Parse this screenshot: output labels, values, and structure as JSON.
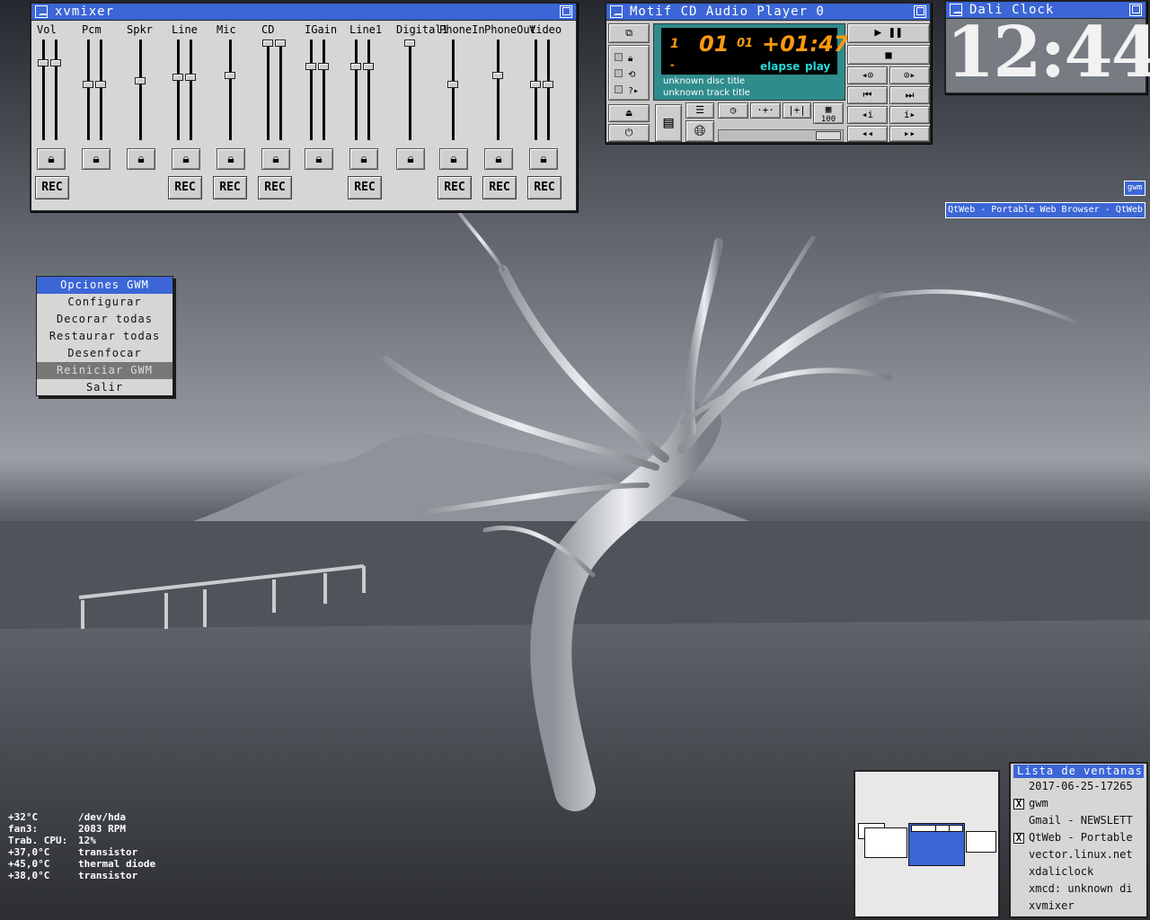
{
  "xvmixer": {
    "title": "xvmixer",
    "channels": [
      {
        "label": "Vol",
        "rec": true
      },
      {
        "label": "Pcm",
        "rec": false
      },
      {
        "label": "Spkr",
        "rec": false
      },
      {
        "label": "Line",
        "rec": true
      },
      {
        "label": "Mic",
        "rec": true
      },
      {
        "label": "CD",
        "rec": true
      },
      {
        "label": "IGain",
        "rec": false
      },
      {
        "label": "Line1",
        "rec": true
      },
      {
        "label": "Digital1",
        "rec": false
      },
      {
        "label": "PhoneIn",
        "rec": true
      },
      {
        "label": "PhoneOut",
        "rec": true
      },
      {
        "label": "Video",
        "rec": true
      }
    ],
    "rec_label": "REC",
    "lock_icon": "padlock-icon"
  },
  "cdplayer": {
    "title": "Motif CD Audio Player 0",
    "lcd": {
      "track": "1",
      "index": "01",
      "index_small": "01",
      "time": "+01:47",
      "dash": "-",
      "mode_elapse": "elapse",
      "mode_play": "play"
    },
    "disc_title": "unknown disc title",
    "track_title": "unknown track title",
    "volume_value": "100"
  },
  "daliclock": {
    "title": "Dali Clock",
    "time": "12:44"
  },
  "gwm_menu": {
    "title": "Opciones GWM",
    "items": [
      "Configurar",
      "Decorar todas",
      "Restaurar todas",
      "Desenfocar",
      "Reiniciar GWM",
      "Salir"
    ]
  },
  "icons": {
    "gwm": "gwm",
    "qtweb": "QtWeb - Portable Web Browser - QtWeb"
  },
  "sensors": [
    {
      "value": "+32°C",
      "label": "/dev/hda"
    },
    {
      "value": "fan3:",
      "label": "2083 RPM"
    },
    {
      "value": "Trab. CPU:",
      "label": "12%"
    },
    {
      "value": "+37,0°C",
      "label": "transistor"
    },
    {
      "value": "+45,0°C",
      "label": "thermal diode"
    },
    {
      "value": "+38,0°C",
      "label": "transistor"
    }
  ],
  "winlist": {
    "title": "Lista de ventanas",
    "items": [
      {
        "label": "2017-06-25-17265",
        "checked": false
      },
      {
        "label": "gwm",
        "checked": true
      },
      {
        "label": "Gmail - NEWSLETT",
        "checked": false
      },
      {
        "label": "QtWeb - Portable",
        "checked": true
      },
      {
        "label": "vector.linux.net",
        "checked": false
      },
      {
        "label": "xdaliclock",
        "checked": false
      },
      {
        "label": "xmcd: unknown di",
        "checked": false
      },
      {
        "label": "xvmixer",
        "checked": false
      }
    ],
    "check_mark": "X"
  },
  "colors": {
    "titlebar": "#3c66d6",
    "lcd_orange": "#ff9a10",
    "lcd_cyan": "#28d8d8",
    "cd_panel": "#2f8c8c"
  }
}
